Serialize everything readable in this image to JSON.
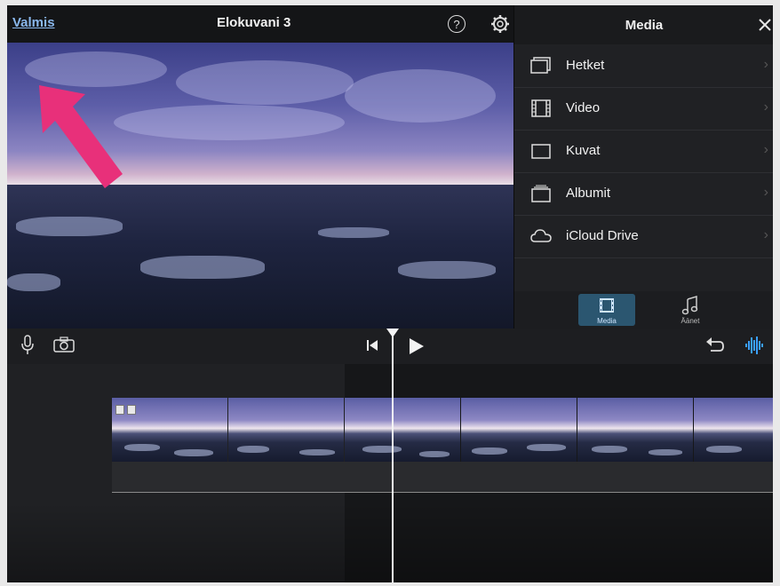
{
  "topbar": {
    "done_label": "Valmis",
    "project_title": "Elokuvani 3",
    "help_glyph": "?"
  },
  "media_panel": {
    "title": "Media",
    "items": [
      {
        "label": "Hetket",
        "icon": "moments-icon"
      },
      {
        "label": "Video",
        "icon": "film-icon"
      },
      {
        "label": "Kuvat",
        "icon": "photo-icon"
      },
      {
        "label": "Albumit",
        "icon": "album-icon"
      },
      {
        "label": "iCloud Drive",
        "icon": "cloud-icon"
      }
    ],
    "tabs": [
      {
        "label": "Media",
        "icon": "media-tab-icon",
        "selected": true
      },
      {
        "label": "Äänet",
        "icon": "music-note-icon",
        "selected": false
      }
    ]
  },
  "colors": {
    "accent": "#8ab8ee",
    "selected_tab": "#2b5670",
    "waveform": "#3aa0ff",
    "annotation_arrow": "#e8307a"
  }
}
